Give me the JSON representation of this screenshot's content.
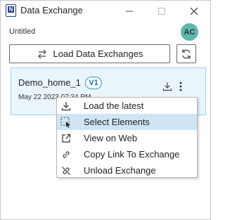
{
  "window": {
    "title": "Data Exchange",
    "app_icon_letter": "N"
  },
  "header": {
    "document_name": "Untitled",
    "avatar_initials": "AC",
    "avatar_color": "#5fb7ad"
  },
  "toolbar": {
    "load_label": "Load Data Exchanges"
  },
  "exchange": {
    "name": "Demo_home_1",
    "version": "V1",
    "date": "May 22 2023 07:34 PM"
  },
  "context_menu": {
    "items": [
      {
        "label": "Load the latest",
        "icon": "download-icon"
      },
      {
        "label": "Select Elements",
        "icon": "select-elements-icon",
        "active": true
      },
      {
        "label": "View on Web",
        "icon": "external-link-icon"
      },
      {
        "label": "Copy Link To Exchange",
        "icon": "link-icon"
      },
      {
        "label": "Unload Exchange",
        "icon": "unlink-icon"
      }
    ]
  },
  "colors": {
    "accent": "#1f6fb5",
    "card_background": "#eaf5fb",
    "menu_highlight": "#cfe5f4"
  }
}
